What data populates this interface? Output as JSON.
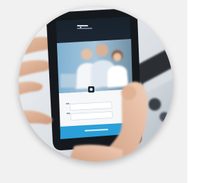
{
  "image": {
    "subject": "hands-holding-smartphone-photo",
    "accent_color": "#2a9fd8",
    "phone_screen_color": "#1d2733"
  },
  "phone": {
    "logo_text": "",
    "field_1_label": "",
    "field_2_label": "",
    "button_label": ""
  }
}
